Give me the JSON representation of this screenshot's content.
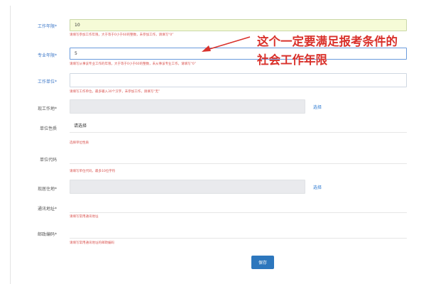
{
  "form": {
    "work_years": {
      "label": "工作年限*",
      "value": "10",
      "hint": "请填写参加工作年限，大于等于0小于60的整数，未参加工作，请填写“0”"
    },
    "major_years": {
      "label": "专业年限*",
      "value": "5",
      "hint": "请填写从事该专业工作的年限，大于等于0小于60的整数，未从事该专业工作，请填写“0”"
    },
    "work_unit": {
      "label": "工作单位*",
      "value": "",
      "hint": "请填写工作单位，最多输入30个汉字，未参加工作，请填写“无”"
    },
    "current_work": {
      "label": "现工作地*",
      "value": "",
      "select_label": "选择"
    },
    "unit_nature": {
      "label": "单位性质",
      "value": "请选择",
      "hint": "选择单位性质"
    },
    "unit_code": {
      "label": "单位代码",
      "value": "",
      "hint": "请填写单位代码，最多10位字符"
    },
    "residence": {
      "label": "现居住地*",
      "value": "",
      "select_label": "选择"
    },
    "mail_address": {
      "label": "通讯地址*",
      "value": "",
      "hint": "请填写常用通讯地址"
    },
    "postal_code": {
      "label": "邮政编码*",
      "value": "",
      "hint": "请填写常用通讯地址的邮政编码"
    },
    "save_label": "保存"
  },
  "annotation": {
    "line1": "这个一定要满足报考条件的",
    "line2": "社会工作年限",
    "color": "#d9312b"
  }
}
